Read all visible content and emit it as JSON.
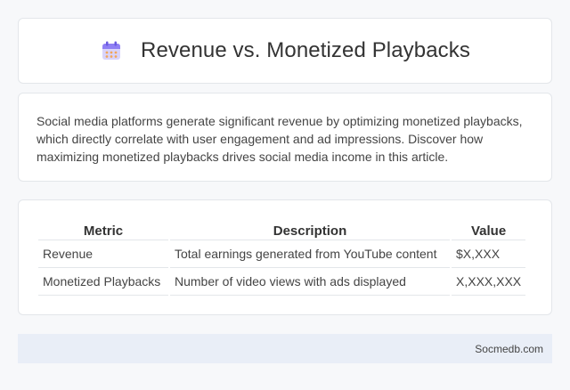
{
  "header": {
    "title": "Revenue vs. Monetized Playbacks",
    "icon": "calendar-icon"
  },
  "intro": {
    "text": "Social media platforms generate significant revenue by optimizing monetized playbacks, which directly correlate with user engagement and ad impressions. Discover how maximizing monetized playbacks drives social media income in this article."
  },
  "table": {
    "headers": [
      "Metric",
      "Description",
      "Value"
    ],
    "rows": [
      [
        "Revenue",
        "Total earnings generated from YouTube content",
        "$X,XXX"
      ],
      [
        "Monetized Playbacks",
        "Number of video views with ads displayed",
        "X,XXX,XXX"
      ]
    ]
  },
  "footer": {
    "source": "Socmedb.com"
  },
  "colors": {
    "background": "#f7f8fa",
    "footer_bg": "#e9eef7",
    "icon_accent": "#7b6cf6"
  }
}
